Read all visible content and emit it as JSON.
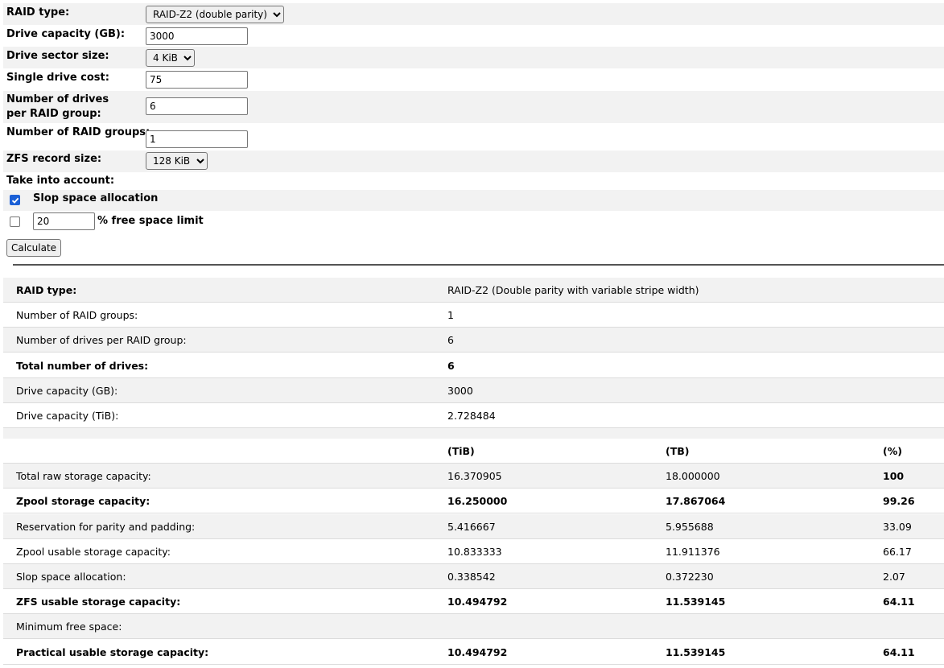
{
  "form": {
    "raid_type_label": "RAID type:",
    "raid_type_value": "RAID-Z2 (double parity)",
    "drive_capacity_label": "Drive capacity (GB):",
    "drive_capacity_value": "3000",
    "sector_size_label": "Drive sector size:",
    "sector_size_value": "4 KiB",
    "drive_cost_label": "Single drive cost:",
    "drive_cost_value": "75",
    "drives_per_group_label": "Number of drives per RAID group:",
    "drives_per_group_value": "6",
    "raid_groups_label": "Number of RAID groups:",
    "raid_groups_value": "1",
    "record_size_label": "ZFS record size:",
    "record_size_value": "128 KiB",
    "take_into_account_label": "Take into account:",
    "slop_label": "Slop space allocation",
    "slop_checked": true,
    "free_space_value": "20",
    "free_space_label": "% free space limit",
    "free_space_checked": false,
    "calculate_label": "Calculate"
  },
  "results": {
    "info_rows": [
      {
        "label": "RAID type:",
        "value": "RAID-Z2 (Double parity with variable stripe width)",
        "bold": true
      },
      {
        "label": "Number of RAID groups:",
        "value": "1",
        "bold": false
      },
      {
        "label": "Number of drives per RAID group:",
        "value": "6",
        "bold": false
      },
      {
        "label": "Total number of drives:",
        "value": "6",
        "bold": true
      },
      {
        "label": "Drive capacity (GB):",
        "value": "3000",
        "bold": false
      },
      {
        "label": "Drive capacity (TiB):",
        "value": "2.728484",
        "bold": false
      }
    ],
    "capacity_headers": [
      "",
      "(TiB)",
      "(TB)",
      "(%)"
    ],
    "capacity_rows": [
      {
        "label": "Total raw storage capacity:",
        "tib": "16.370905",
        "tb": "18.000000",
        "pct": "100",
        "bold": false
      },
      {
        "label": "Zpool storage capacity:",
        "tib": "16.250000",
        "tb": "17.867064",
        "pct": "99.26",
        "bold": true
      },
      {
        "label": "Reservation for parity and padding:",
        "tib": "5.416667",
        "tb": "5.955688",
        "pct": "33.09",
        "bold": false
      },
      {
        "label": "Zpool usable storage capacity:",
        "tib": "10.833333",
        "tb": "11.911376",
        "pct": "66.17",
        "bold": false
      },
      {
        "label": "Slop space allocation:",
        "tib": "0.338542",
        "tb": "0.372230",
        "pct": "2.07",
        "bold": false
      },
      {
        "label": "ZFS usable storage capacity:",
        "tib": "10.494792",
        "tb": "11.539145",
        "pct": "64.11",
        "bold": true
      },
      {
        "label": "Minimum free space:",
        "tib": "",
        "tb": "",
        "pct": "",
        "bold": false
      },
      {
        "label": "Practical usable storage capacity:",
        "tib": "10.494792",
        "tb": "11.539145",
        "pct": "64.11",
        "bold": true
      }
    ]
  }
}
